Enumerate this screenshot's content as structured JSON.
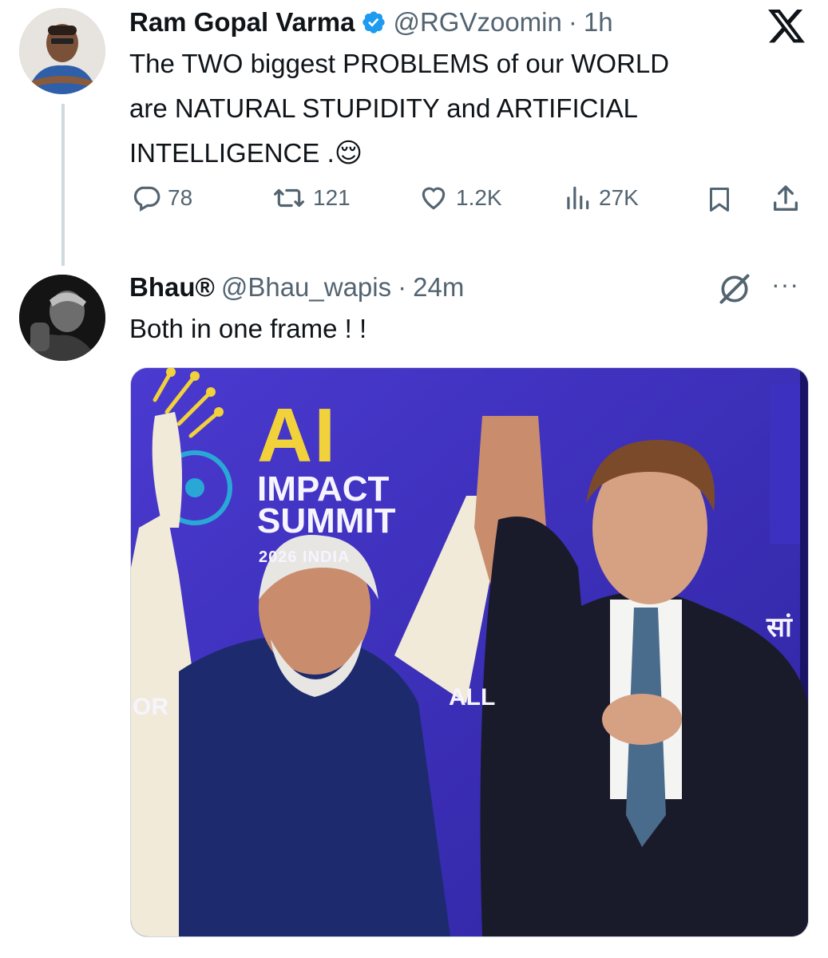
{
  "tweet": {
    "display_name": "Ram Gopal Varma",
    "handle": "@RGVzoomin",
    "separator": "·",
    "time": "1h",
    "text_lines": [
      "The TWO biggest PROBLEMS of our  WORLD",
      "are NATURAL STUPIDITY and ARTIFICIAL",
      "INTELLIGENCE ."
    ],
    "emoji": "😌",
    "metrics": {
      "replies": "78",
      "retweets": "121",
      "likes": "1.2K",
      "views": "27K"
    }
  },
  "reply": {
    "display_name": "Bhau®",
    "handle": "@Bhau_wapis",
    "separator": "·",
    "time": "24m",
    "text": "Both in one frame ! !",
    "more": "···",
    "media": {
      "logo_big": "AI",
      "logo_line1": "IMPACT",
      "logo_line2": "SUMMIT",
      "logo_line3": "2026 INDIA",
      "bg_text_left": "OR",
      "bg_text_mid": "ALL",
      "bg_text_right": "सां"
    }
  },
  "colors": {
    "verified": "#1d9bf0",
    "muted": "#536471",
    "text": "#0f1419",
    "stage_bg": "#3a2fb8"
  },
  "icons": [
    "x-logo-icon",
    "verified-badge-icon",
    "reply-icon",
    "retweet-icon",
    "like-icon",
    "views-icon",
    "bookmark-icon",
    "share-icon",
    "grok-icon",
    "more-icon"
  ]
}
